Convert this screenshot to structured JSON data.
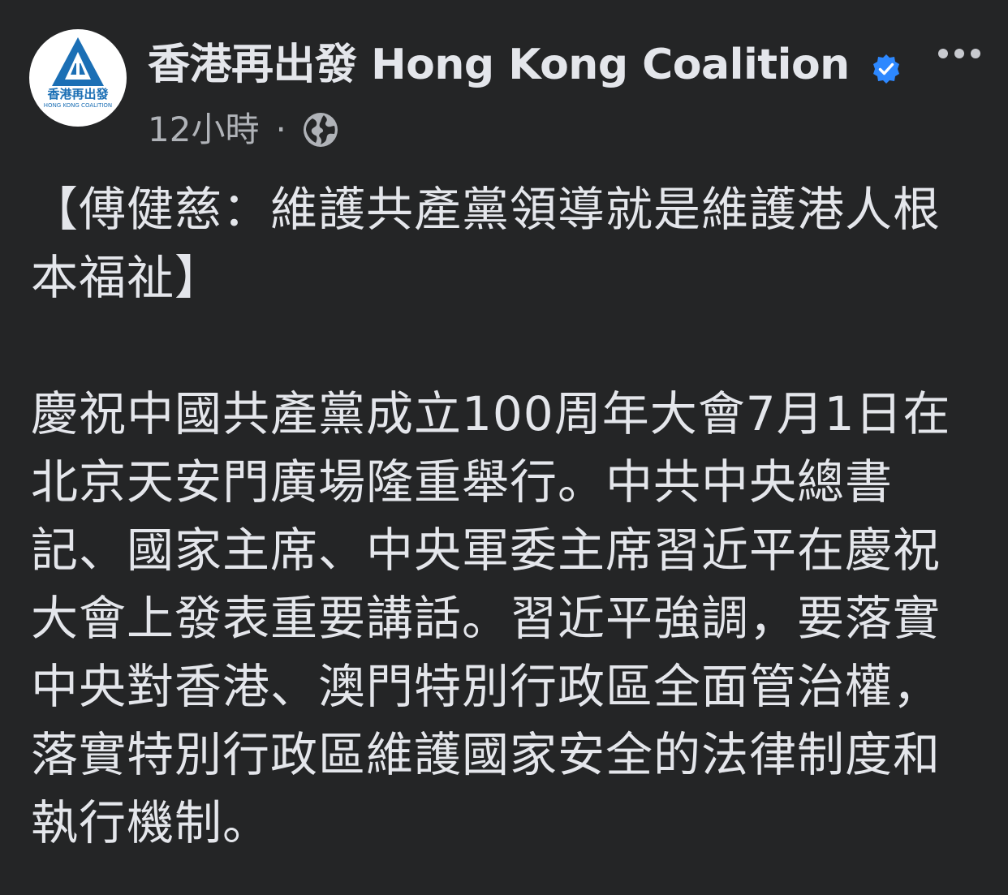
{
  "page": {
    "name": "香港再出發 Hong Kong Coalition",
    "verified": true,
    "avatar_text_cn": "香港再出發",
    "avatar_text_en": "HONG KONG COALITION",
    "brand_color": "#1b6fb5",
    "verified_color": "#2d88ff",
    "avatar_icon": "mountain-arrow-logo"
  },
  "meta": {
    "timestamp": "12小時",
    "separator": "·",
    "audience_icon": "globe-icon"
  },
  "menu": {
    "icon": "more-options-icon"
  },
  "post": {
    "headline": "【傅健慈：維護共產黨領導就是維護港人根本福祉】",
    "body": "慶祝中國共產黨成立100周年大會7月1日在北京天安門廣場隆重舉行。中共中央總書記、國家主席、中央軍委主席習近平在慶祝大會上發表重要講話。習近平強調，要落實中央對香港、澳門特別行政區全面管治權，落實特別行政區維護國家安全的法律制度和執行機制。"
  },
  "theme": {
    "background": "#242526",
    "primary_text": "#e4e6eb",
    "secondary_text": "#b0b3b8"
  }
}
